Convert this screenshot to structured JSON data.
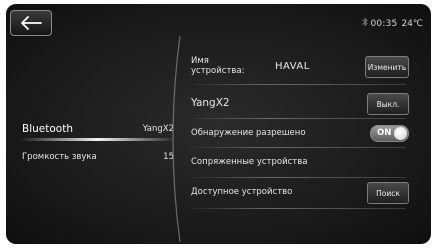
{
  "colors": {
    "background": "#181818",
    "text": "#e8e8e8",
    "button": "#2e2e2e",
    "toggle_on": "#8a8a8a"
  },
  "topbar": {
    "back_icon": "arrow-left-icon",
    "bluetooth_icon": "bluetooth-icon",
    "time": "00:35",
    "temperature": "24℃"
  },
  "left_menu": {
    "items": [
      {
        "label": "Bluetooth",
        "value": "YangX2",
        "selected": true
      },
      {
        "label": "Громкость звука",
        "value": "15",
        "selected": false
      }
    ]
  },
  "settings": {
    "device_name_label": "Имя\nустройства:",
    "device_name_value": "HAVAL",
    "rename_button": "Изменить",
    "connected_phone": "YangX2",
    "disconnect_button": "Выкл.",
    "discoverable_label": "Обнаружение разрешено",
    "discoverable_state": "ON",
    "paired_devices_label": "Сопряженные устройства",
    "available_device_label": "Доступное устройство",
    "search_button": "Поиск"
  }
}
